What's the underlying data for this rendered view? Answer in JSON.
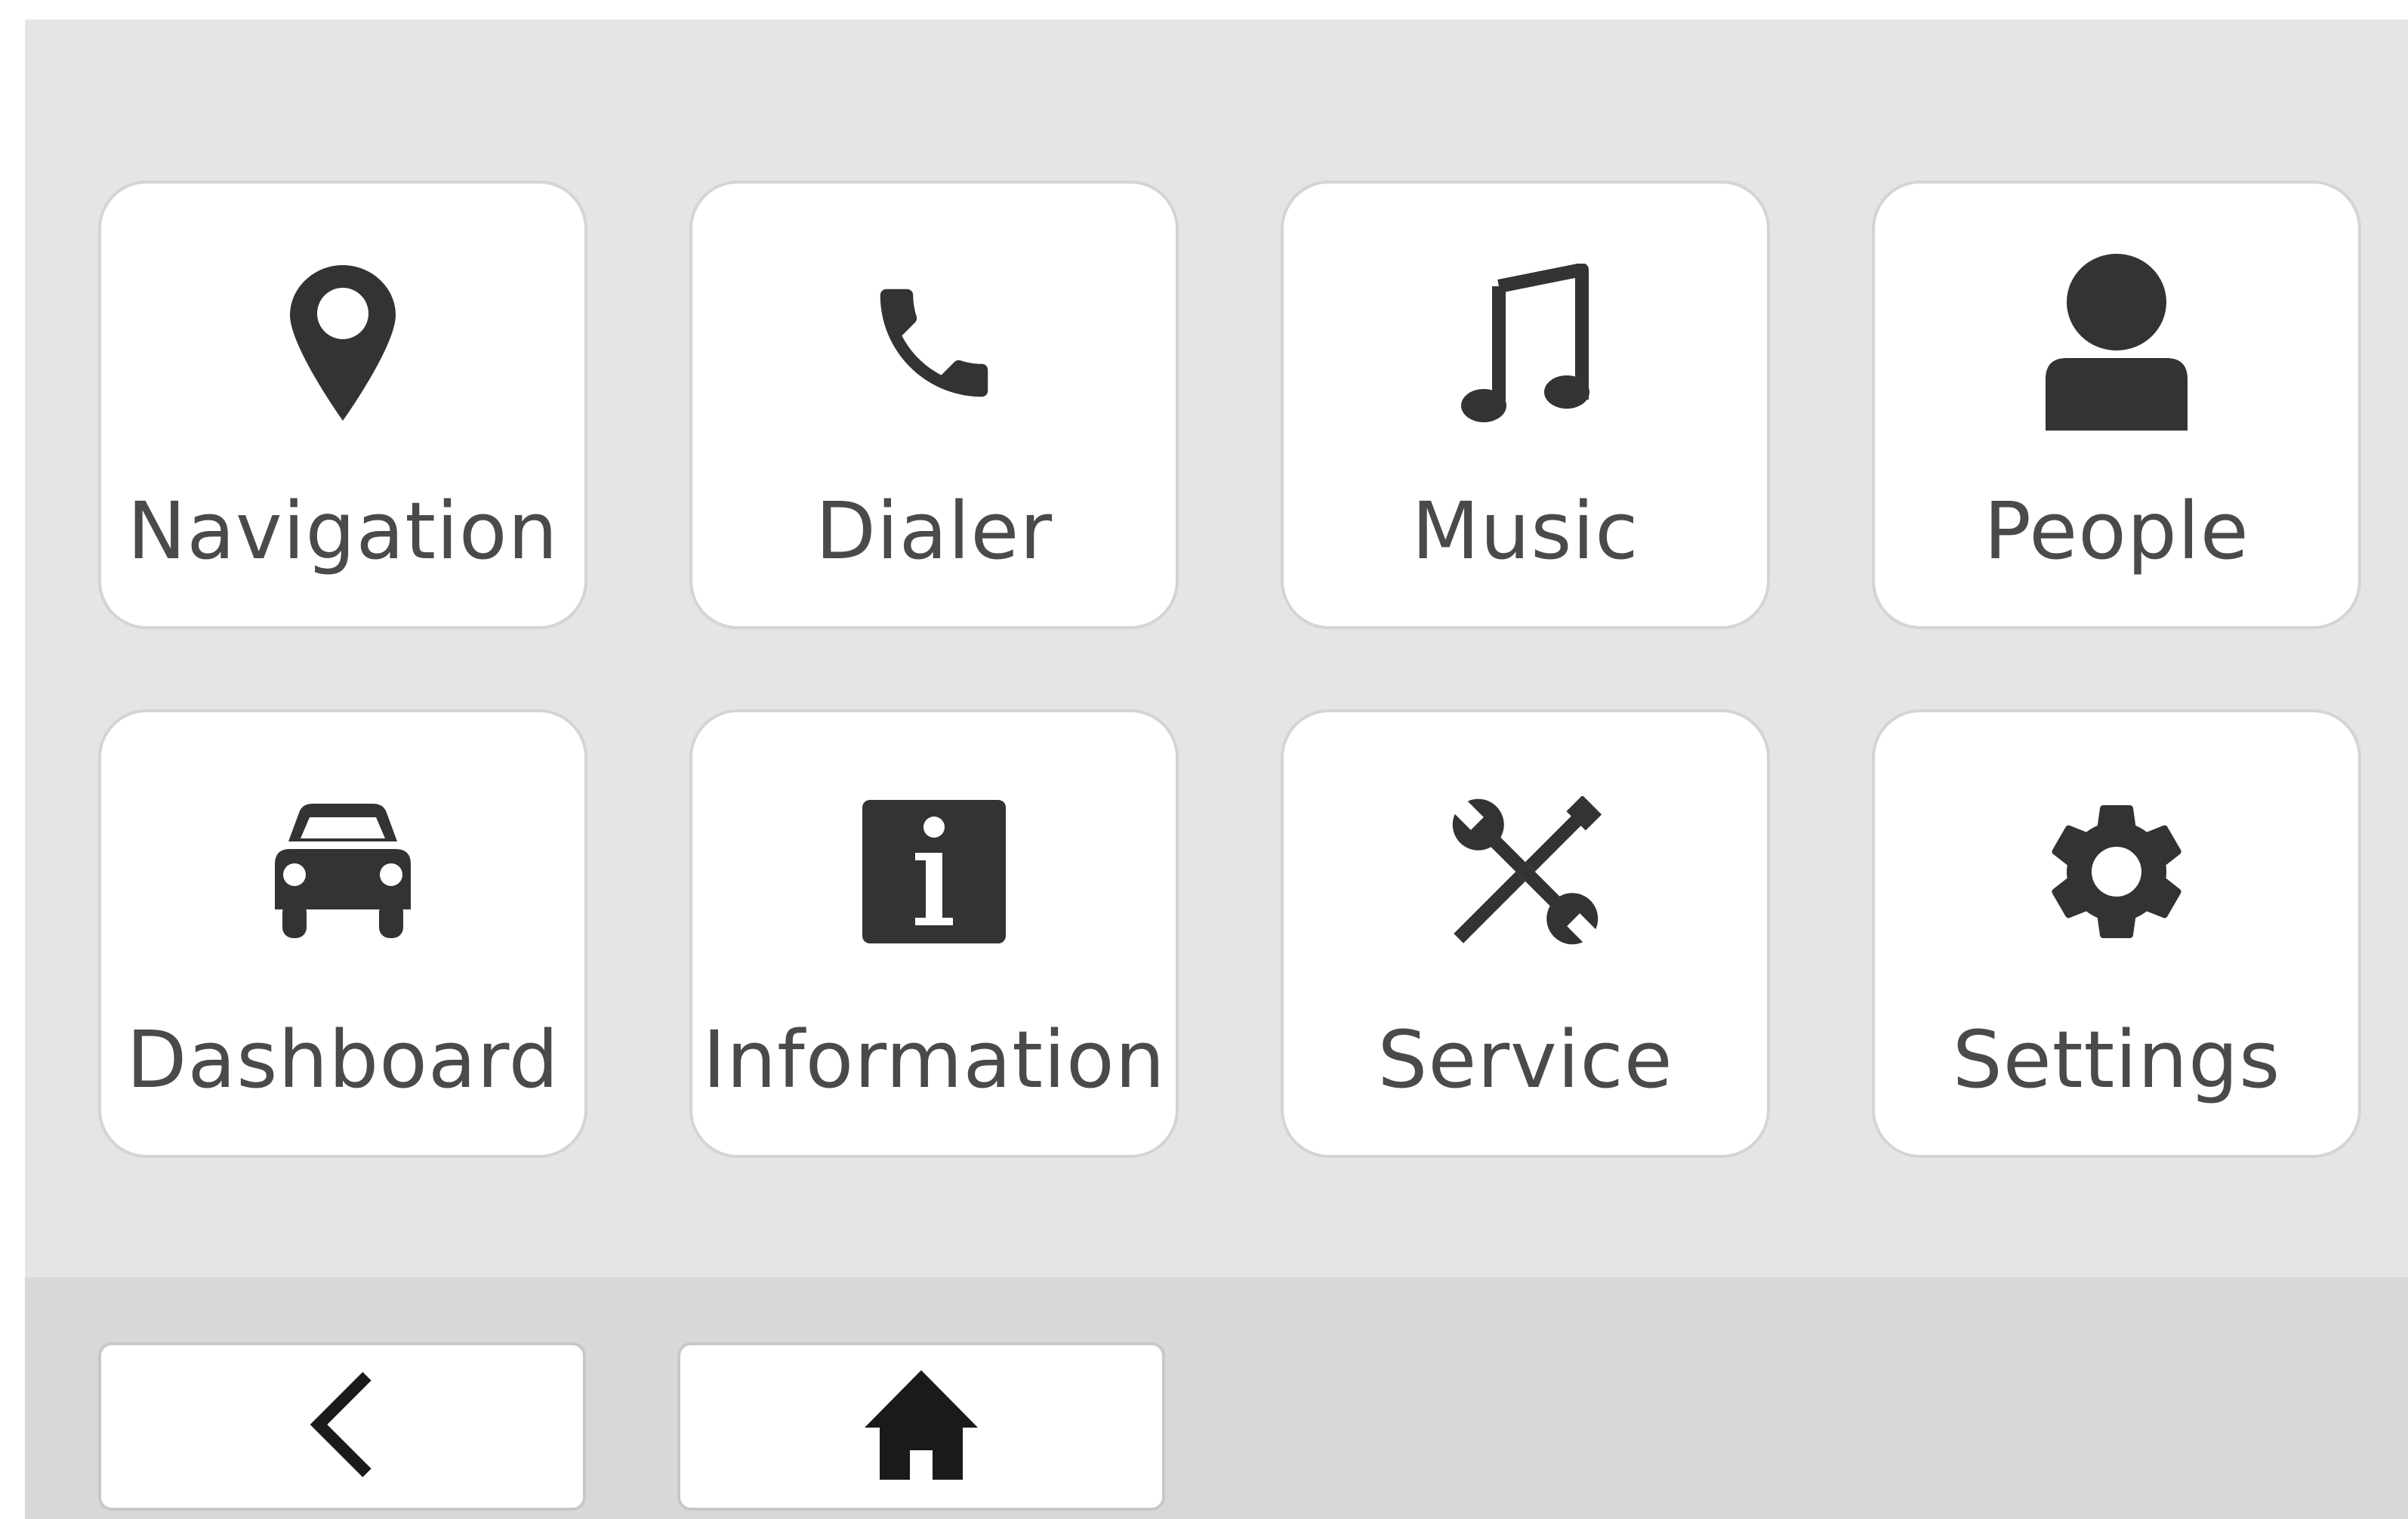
{
  "launcher": {
    "tiles": [
      {
        "label": "Navigation",
        "icon": "map-pin-icon"
      },
      {
        "label": "Dialer",
        "icon": "phone-icon"
      },
      {
        "label": "Music",
        "icon": "music-note-icon"
      },
      {
        "label": "People",
        "icon": "person-icon"
      },
      {
        "label": "Dashboard",
        "icon": "car-icon"
      },
      {
        "label": "Information",
        "icon": "info-icon"
      },
      {
        "label": "Service",
        "icon": "tools-icon"
      },
      {
        "label": "Settings",
        "icon": "gear-icon"
      }
    ]
  },
  "nav": {
    "back_icon": "chevron-left-icon",
    "home_icon": "home-icon"
  },
  "colors": {
    "background": "#e5e5e5",
    "bottom_bar": "#d8d8d8",
    "tile": "#ffffff",
    "tile_border": "#d4d4d4",
    "icon": "#333333",
    "label": "#4a4a4a"
  }
}
